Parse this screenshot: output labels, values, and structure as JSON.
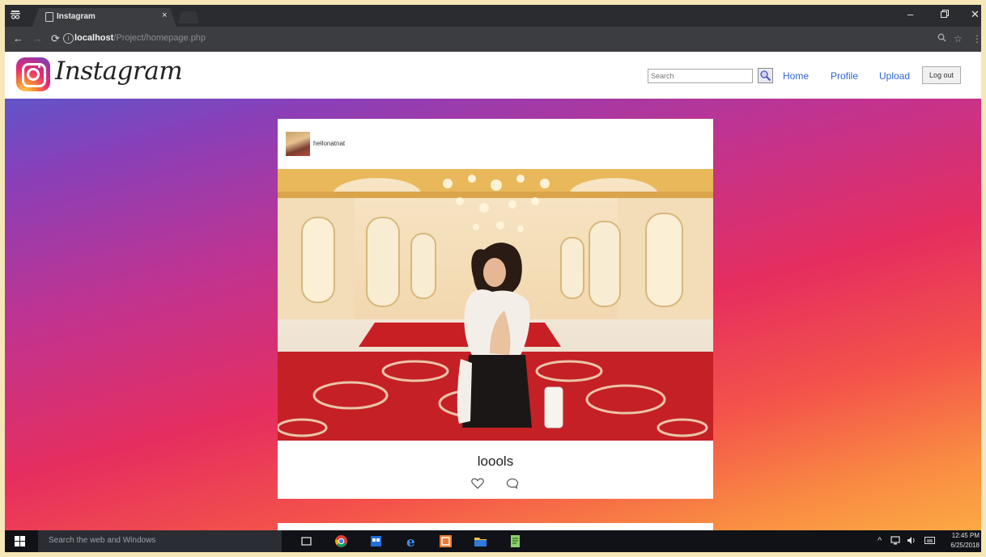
{
  "browser": {
    "tab_title": "Instagram",
    "tab_close": "×",
    "url_host": "localhost",
    "url_path": "/Project/homepage.php"
  },
  "header": {
    "logo_text": "Instagram",
    "search_placeholder": "Search",
    "nav": {
      "home": "Home",
      "profile": "Profile",
      "upload": "Upload",
      "logout": "Log out"
    }
  },
  "post": {
    "username": "hellonatnat",
    "caption": "loools"
  },
  "taskbar": {
    "search_placeholder": "Search the web and Windows",
    "time": "12:45 PM",
    "date": "6/25/2018"
  },
  "colors": {
    "link": "#2f66d0",
    "chrome_dark": "#2b2c2f",
    "taskbar": "#101217"
  }
}
